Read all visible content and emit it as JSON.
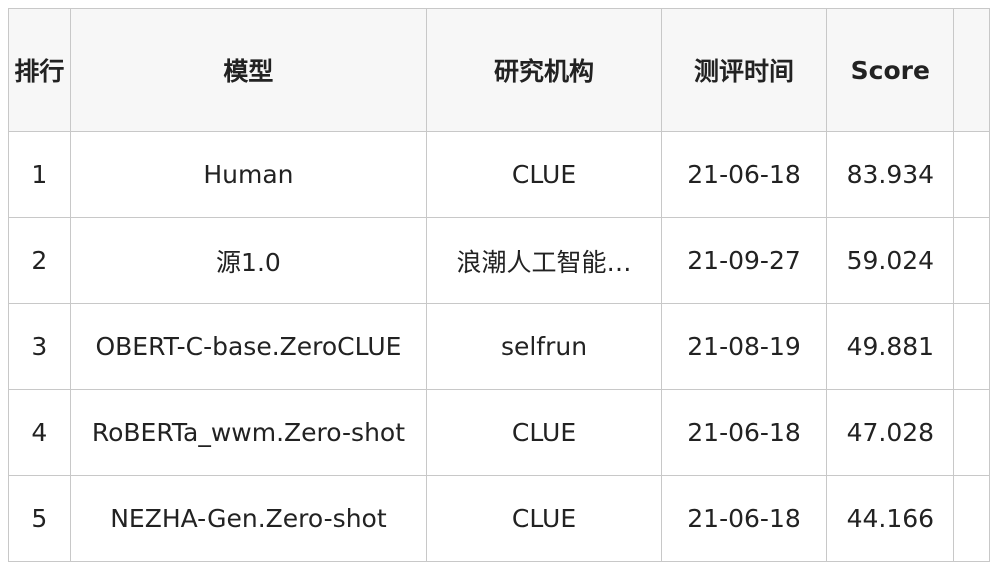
{
  "table": {
    "headers": {
      "rank": "排行",
      "model": "模型",
      "org": "研究机构",
      "date": "测评时间",
      "score": "Score"
    },
    "rows": [
      {
        "rank": "1",
        "model": "Human",
        "org": "CLUE",
        "date": "21-06-18",
        "score": "83.934"
      },
      {
        "rank": "2",
        "model": "源1.0",
        "org": "浪潮人工智能…",
        "date": "21-09-27",
        "score": "59.024"
      },
      {
        "rank": "3",
        "model": "OBERT-C-base.ZeroCLUE",
        "org": "selfrun",
        "date": "21-08-19",
        "score": "49.881"
      },
      {
        "rank": "4",
        "model": "RoBERTa_wwm.Zero-shot",
        "org": "CLUE",
        "date": "21-06-18",
        "score": "47.028"
      },
      {
        "rank": "5",
        "model": "NEZHA-Gen.Zero-shot",
        "org": "CLUE",
        "date": "21-06-18",
        "score": "44.166"
      }
    ]
  },
  "colors": {
    "link": "#5a66a8",
    "top_score": "#d93a2b",
    "header_bg": "#f7f7f7",
    "border": "#c8c8c8"
  }
}
